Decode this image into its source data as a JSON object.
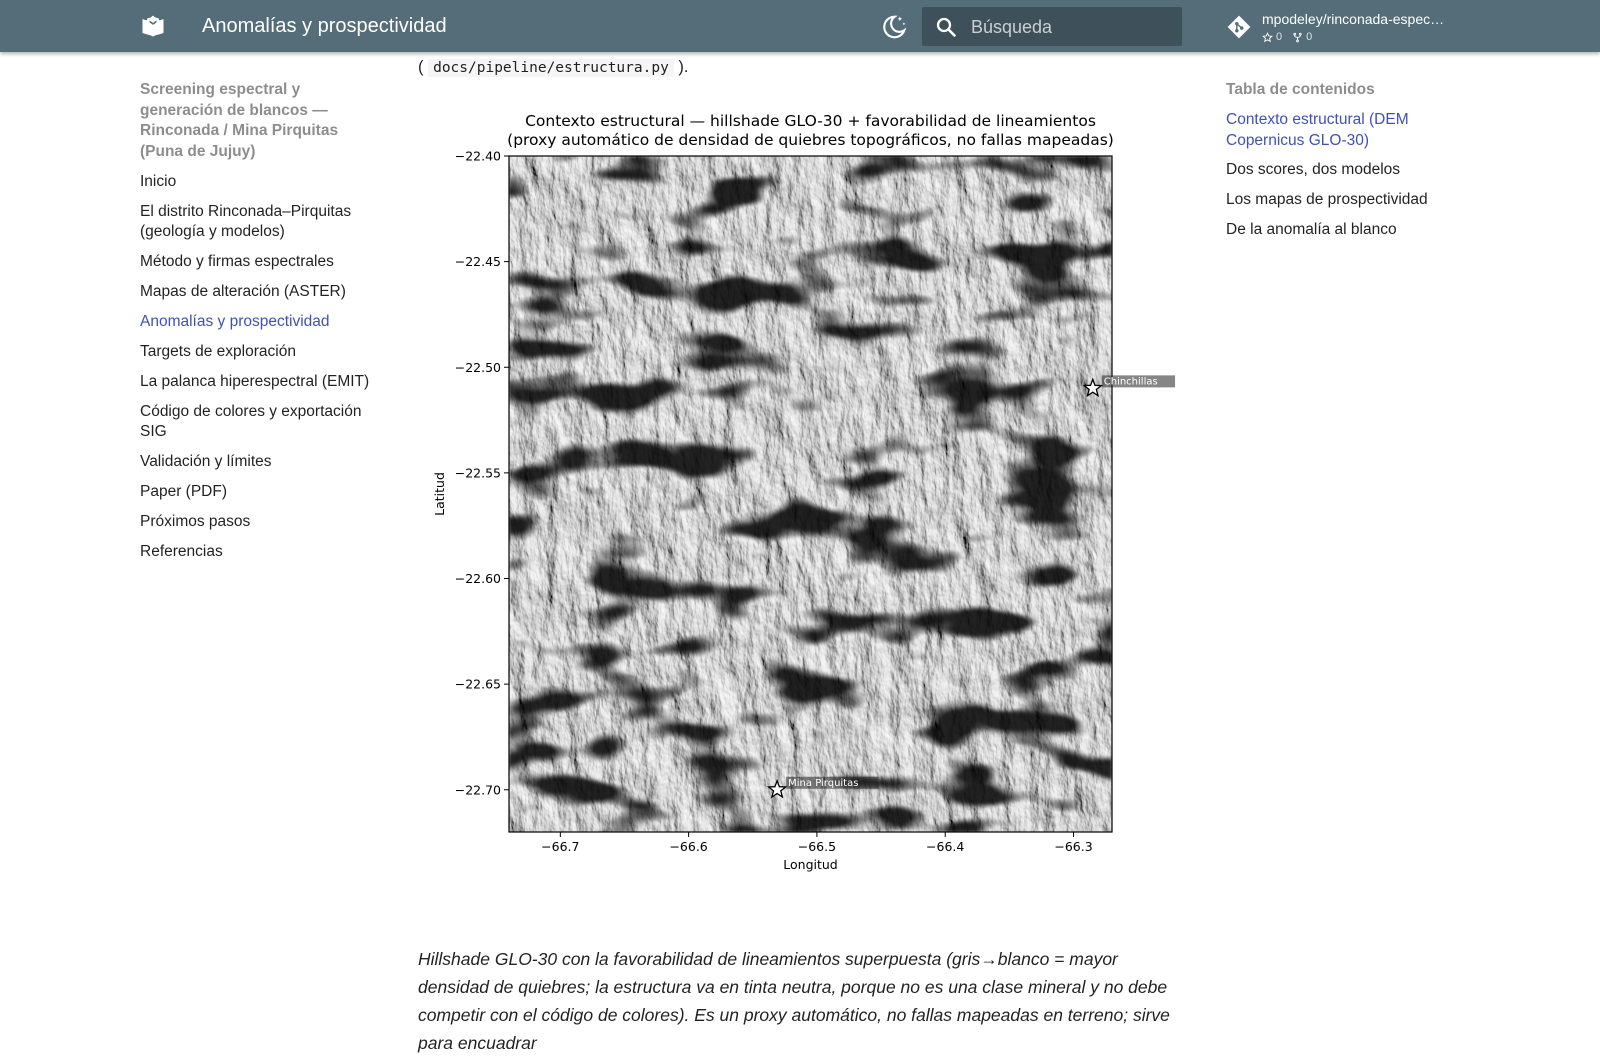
{
  "header": {
    "title": "Anomalías y prospectividad",
    "search_placeholder": "Búsqueda",
    "repo_name": "mpodeley/rinconada-espec…",
    "repo_stars": "0",
    "repo_forks": "0",
    "icons": {
      "logo": "book-open-icon",
      "theme": "dark-mode-icon",
      "search": "search-icon",
      "repo": "git-icon"
    },
    "colors": {
      "primary": "#546d78",
      "accent": "#4051b5"
    }
  },
  "nav": {
    "title": "Screening espectral y generación de blancos — Rinconada / Mina Pirquitas (Puna de Jujuy)",
    "items": [
      {
        "label": "Inicio"
      },
      {
        "label": "El distrito Rinconada–Pirquitas (geología y modelos)"
      },
      {
        "label": "Método y firmas espectrales"
      },
      {
        "label": "Mapas de alteración (ASTER)"
      },
      {
        "label": "Anomalías y prospectividad",
        "active": true
      },
      {
        "label": "Targets de exploración"
      },
      {
        "label": "La palanca hiperespectral (EMIT)"
      },
      {
        "label": "Código de colores y exportación SIG"
      },
      {
        "label": "Validación y límites"
      },
      {
        "label": "Paper (PDF)"
      },
      {
        "label": "Próximos pasos"
      },
      {
        "label": "Referencias"
      }
    ]
  },
  "toc": {
    "title": "Tabla de contenidos",
    "items": [
      {
        "label": "Contexto estructural (DEM Copernicus GLO-30)",
        "active": true
      },
      {
        "label": "Dos scores, dos modelos"
      },
      {
        "label": "Los mapas de prospectividad"
      },
      {
        "label": "De la anomalía al blanco"
      }
    ]
  },
  "content": {
    "code_prefix": "(",
    "code_path": "docs/pipeline/estructura.py",
    "code_suffix": ").",
    "caption": "Hillshade GLO-30 con la favorabilidad de lineamientos superpuesta (gris→blanco = mayor densidad de quiebres; la estructura va en tinta neutra, porque no es una clase mineral y no debe competir con el código de colores). Es un proxy automático, no fallas mapeadas en terreno; sirve para encuadrar"
  },
  "chart_data": {
    "type": "heatmap",
    "title_line1": "Contexto estructural — hillshade GLO-30 + favorabilidad de lineamientos",
    "title_line2": "(proxy automático de densidad de quiebres topográficos, no fallas mapeadas)",
    "xlabel": "Longitud",
    "ylabel": "Latitud",
    "xlim": [
      -66.74,
      -66.27
    ],
    "ylim": [
      -22.72,
      -22.4
    ],
    "y_inverted": true,
    "xticks": [
      {
        "v": -66.7,
        "label": "−66.7"
      },
      {
        "v": -66.6,
        "label": "−66.6"
      },
      {
        "v": -66.5,
        "label": "−66.5"
      },
      {
        "v": -66.4,
        "label": "−66.4"
      },
      {
        "v": -66.3,
        "label": "−66.3"
      }
    ],
    "yticks": [
      {
        "v": -22.4,
        "label": "−22.40"
      },
      {
        "v": -22.45,
        "label": "−22.45"
      },
      {
        "v": -22.5,
        "label": "−22.50"
      },
      {
        "v": -22.55,
        "label": "−22.55"
      },
      {
        "v": -22.6,
        "label": "−22.60"
      },
      {
        "v": -22.65,
        "label": "−22.65"
      },
      {
        "v": -22.7,
        "label": "−22.70"
      }
    ],
    "points": [
      {
        "name": "Chinchillas",
        "lon": -66.285,
        "lat": -22.51
      },
      {
        "name": "Mina Pirquitas",
        "lon": -66.531,
        "lat": -22.7
      }
    ],
    "colors": {
      "marker": "#ffffff"
    }
  }
}
